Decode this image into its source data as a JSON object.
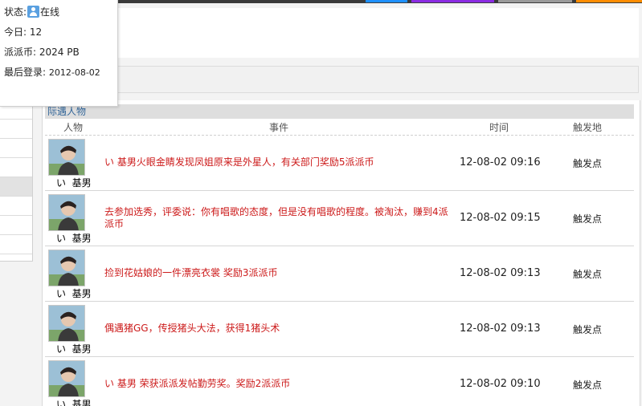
{
  "profile_popup": {
    "status_label": "状态:",
    "status_value": "在线",
    "today_label": "今日:",
    "today_value": "12",
    "coins_label": "派派币:",
    "coins_value": "2024 PB",
    "last_login_label": "最后登录:",
    "last_login_value": "2012-08-02"
  },
  "section": {
    "title": "际遇人物",
    "columns": {
      "person": "人物",
      "event": "事件",
      "time": "时间",
      "place": "触发地"
    }
  },
  "feed": [
    {
      "user": "い  基男",
      "event": "い  基男火眼金睛发现凤姐原来是外星人，有关部门奖励5派派币",
      "time": "12-08-02 09:16",
      "place": "触发点"
    },
    {
      "user": "い  基男",
      "event": "去参加选秀，评委说：你有唱歌的态度，但是没有唱歌的程度。被淘汰，赚到4派派币",
      "time": "12-08-02 09:15",
      "place": "触发点"
    },
    {
      "user": "い  基男",
      "event": "捡到花姑娘的一件漂亮衣裳 奖励3派派币",
      "time": "12-08-02 09:13",
      "place": "触发点"
    },
    {
      "user": "い  基男",
      "event": "偶遇猪GG，传授猪头大法，获得1猪头术",
      "time": "12-08-02 09:13",
      "place": "触发点"
    },
    {
      "user": "い  基男",
      "event": "い  基男 荣获派派发帖勤劳奖。奖励2派派币",
      "time": "12-08-02 09:10",
      "place": "触发点"
    }
  ],
  "colors": {
    "event_text": "#cc1a1a",
    "section_title": "#336699",
    "topbar_tabs": [
      "#1e90ff",
      "#8a2be2",
      "#9a9a9a",
      "#ff8c00"
    ]
  }
}
